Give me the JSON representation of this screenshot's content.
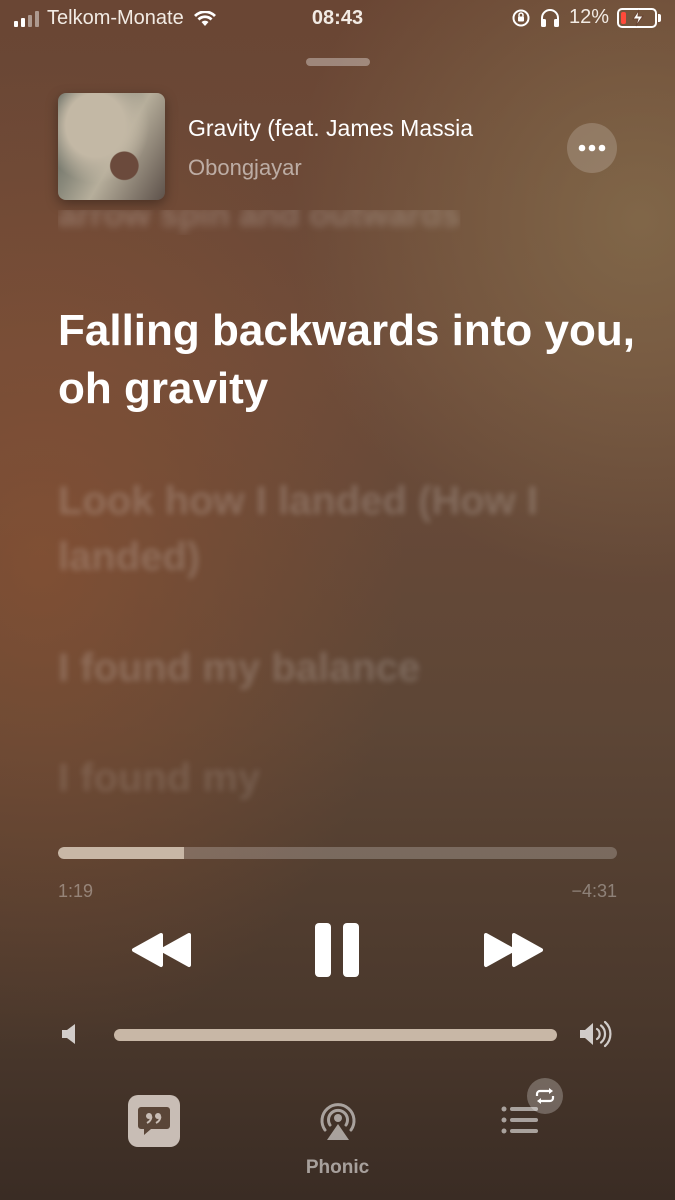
{
  "status_bar": {
    "carrier": "Telkom-Monate",
    "time": "08:43",
    "battery_percent": "12%",
    "battery_level": 0.12,
    "battery_color": "#ff4a3a"
  },
  "now_playing": {
    "title": "Gravity (feat. James Massia",
    "artist": "Obongjayar"
  },
  "lyrics": {
    "previous": "arrow spin and outwards",
    "current": "Falling backwards into you, oh gravity",
    "upcoming": [
      "Look how I landed (How I landed)",
      "I found my balance",
      "I found my"
    ]
  },
  "playback": {
    "elapsed": "1:19",
    "remaining": "−4:31",
    "progress": 0.226,
    "volume": 1.0
  },
  "controls": {
    "rewind_icon": "rewind-icon",
    "pause_icon": "pause-icon",
    "forward_icon": "fast-forward-icon"
  },
  "bottom_bar": {
    "airplay_label": "Phonic"
  },
  "colors": {
    "accent_fill": "#c8b7a6",
    "lyrics_button_bg": "#c8bdb5"
  }
}
